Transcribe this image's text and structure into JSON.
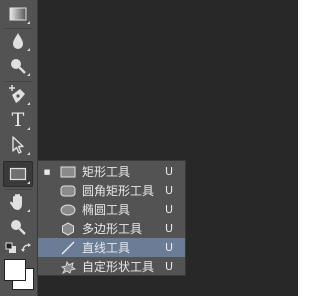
{
  "colors": {
    "workspace": "#282828",
    "toolbar": "#535353",
    "menu_bg": "#535353",
    "selection": "#6a7c96",
    "text": "#e8e8e8"
  },
  "toolbar": {
    "tools": [
      {
        "name": "gradient-tool",
        "icon": "gradient-icon"
      },
      {
        "name": "blur-tool",
        "icon": "drop-icon"
      },
      {
        "name": "dodge-tool",
        "icon": "dodge-icon"
      },
      {
        "name": "pen-tool",
        "icon": "pen-icon"
      },
      {
        "name": "type-tool",
        "icon": "type-icon",
        "glyph": "T"
      },
      {
        "name": "path-selection-tool",
        "icon": "arrow-icon"
      },
      {
        "name": "shape-tool",
        "icon": "rectangle-icon",
        "active": true
      },
      {
        "name": "hand-tool",
        "icon": "hand-icon"
      },
      {
        "name": "zoom-tool",
        "icon": "magnifier-icon"
      }
    ]
  },
  "flyout_menu": {
    "items": [
      {
        "label": "矩形工具",
        "shortcut": "U",
        "icon": "rectangle-icon",
        "current": true,
        "highlighted": false
      },
      {
        "label": "圆角矩形工具",
        "shortcut": "U",
        "icon": "rounded-rectangle-icon",
        "current": false,
        "highlighted": false
      },
      {
        "label": "椭圆工具",
        "shortcut": "U",
        "icon": "ellipse-icon",
        "current": false,
        "highlighted": false
      },
      {
        "label": "多边形工具",
        "shortcut": "U",
        "icon": "polygon-icon",
        "current": false,
        "highlighted": false
      },
      {
        "label": "直线工具",
        "shortcut": "U",
        "icon": "line-icon",
        "current": false,
        "highlighted": true
      },
      {
        "label": "自定形状工具",
        "shortcut": "U",
        "icon": "custom-shape-icon",
        "current": false,
        "highlighted": false
      }
    ]
  }
}
